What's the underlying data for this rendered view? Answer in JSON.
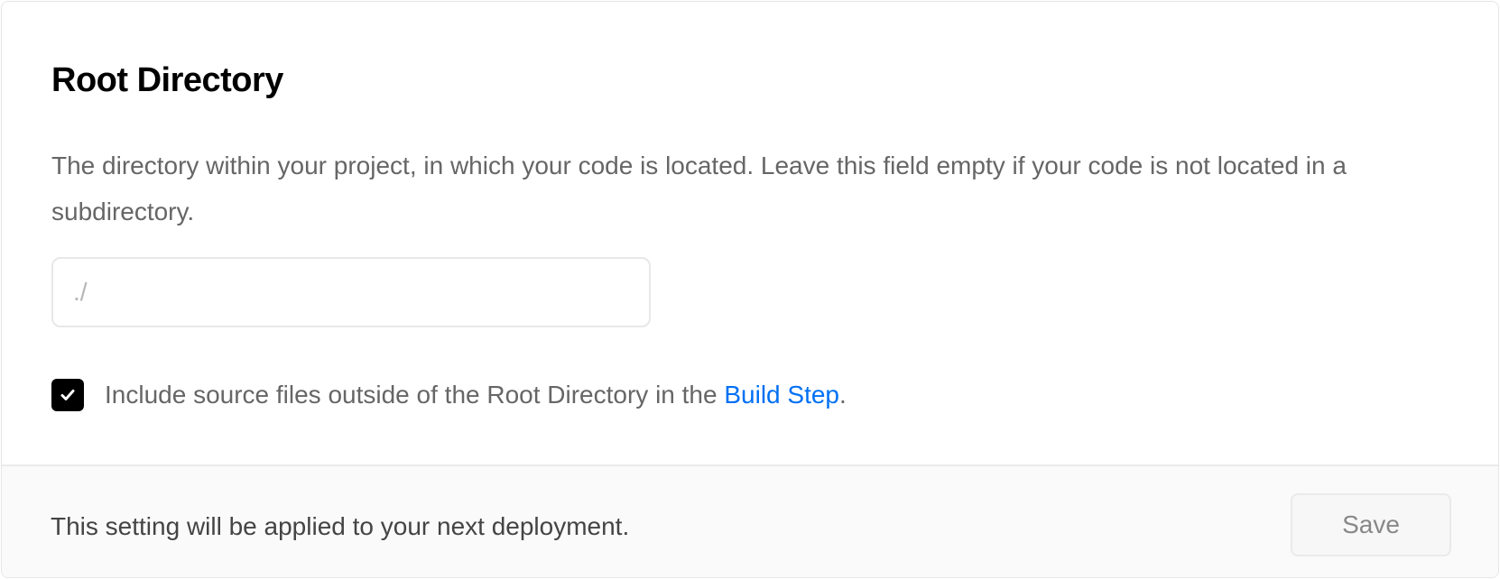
{
  "section": {
    "title": "Root Directory",
    "description": "The directory within your project, in which your code is located. Leave this field empty if your code is not located in a subdirectory."
  },
  "input": {
    "value": "",
    "placeholder": "./"
  },
  "checkbox": {
    "checked": true,
    "label_prefix": "Include source files outside of the Root Directory in the ",
    "link_text": "Build Step",
    "label_suffix": "."
  },
  "footer": {
    "note": "This setting will be applied to your next deployment.",
    "save_label": "Save"
  },
  "colors": {
    "link": "#0070f3",
    "checkbox": "#000000"
  }
}
